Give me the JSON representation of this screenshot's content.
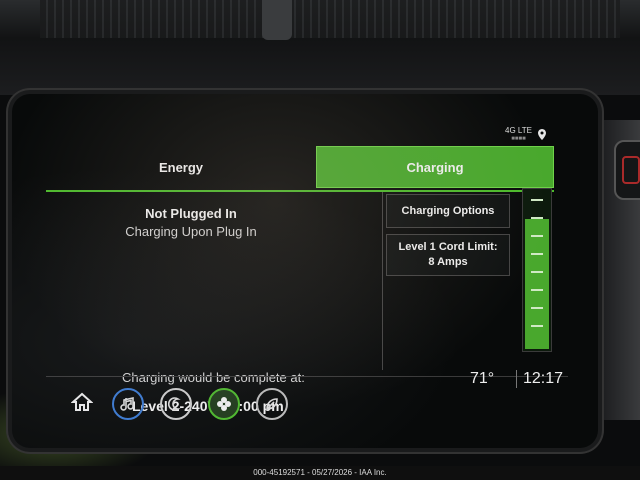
{
  "status": {
    "network": "4G LTE",
    "signal_bars": "■■■■"
  },
  "tabs": [
    {
      "label": "Energy",
      "active": false
    },
    {
      "label": "Charging",
      "active": true
    }
  ],
  "charge_status": {
    "title": "Not Plugged In",
    "subtitle": "Charging Upon Plug In",
    "complete_label": "Charging would be complete at:",
    "level": "Level 2-240V",
    "time": "3:00 pm"
  },
  "options": {
    "charging_options_label": "Charging Options",
    "cord_limit_label": "Level 1 Cord Limit:",
    "cord_limit_value": "8 Amps"
  },
  "gauge": {
    "fill_fraction": 0.82
  },
  "footer": {
    "temperature": "71°",
    "clock": "12:17"
  },
  "nav": [
    {
      "icon": "home-icon"
    },
    {
      "icon": "music-note-icon"
    },
    {
      "icon": "phone-icon"
    },
    {
      "icon": "apps-icon"
    },
    {
      "icon": "leaf-icon"
    }
  ],
  "caption": "000-45192571 - 05/27/2026 - IAA Inc.",
  "colors": {
    "accent_green": "#49a82d",
    "music_blue": "#3a7bd5"
  }
}
